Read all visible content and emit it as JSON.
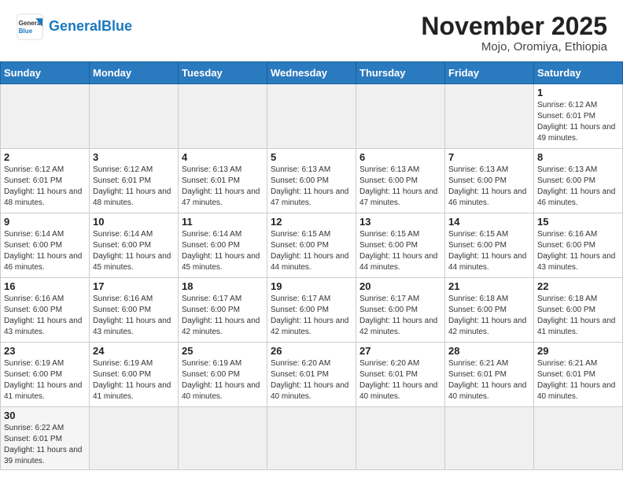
{
  "header": {
    "logo_general": "General",
    "logo_blue": "Blue",
    "month": "November 2025",
    "location": "Mojo, Oromiya, Ethiopia"
  },
  "days_of_week": [
    "Sunday",
    "Monday",
    "Tuesday",
    "Wednesday",
    "Thursday",
    "Friday",
    "Saturday"
  ],
  "weeks": [
    [
      {
        "day": "",
        "empty": true
      },
      {
        "day": "",
        "empty": true
      },
      {
        "day": "",
        "empty": true
      },
      {
        "day": "",
        "empty": true
      },
      {
        "day": "",
        "empty": true
      },
      {
        "day": "",
        "empty": true
      },
      {
        "day": "1",
        "sunrise": "Sunrise: 6:12 AM",
        "sunset": "Sunset: 6:01 PM",
        "daylight": "Daylight: 11 hours and 49 minutes."
      }
    ],
    [
      {
        "day": "2",
        "sunrise": "Sunrise: 6:12 AM",
        "sunset": "Sunset: 6:01 PM",
        "daylight": "Daylight: 11 hours and 48 minutes."
      },
      {
        "day": "3",
        "sunrise": "Sunrise: 6:12 AM",
        "sunset": "Sunset: 6:01 PM",
        "daylight": "Daylight: 11 hours and 48 minutes."
      },
      {
        "day": "4",
        "sunrise": "Sunrise: 6:13 AM",
        "sunset": "Sunset: 6:01 PM",
        "daylight": "Daylight: 11 hours and 47 minutes."
      },
      {
        "day": "5",
        "sunrise": "Sunrise: 6:13 AM",
        "sunset": "Sunset: 6:00 PM",
        "daylight": "Daylight: 11 hours and 47 minutes."
      },
      {
        "day": "6",
        "sunrise": "Sunrise: 6:13 AM",
        "sunset": "Sunset: 6:00 PM",
        "daylight": "Daylight: 11 hours and 47 minutes."
      },
      {
        "day": "7",
        "sunrise": "Sunrise: 6:13 AM",
        "sunset": "Sunset: 6:00 PM",
        "daylight": "Daylight: 11 hours and 46 minutes."
      },
      {
        "day": "8",
        "sunrise": "Sunrise: 6:13 AM",
        "sunset": "Sunset: 6:00 PM",
        "daylight": "Daylight: 11 hours and 46 minutes."
      }
    ],
    [
      {
        "day": "9",
        "sunrise": "Sunrise: 6:14 AM",
        "sunset": "Sunset: 6:00 PM",
        "daylight": "Daylight: 11 hours and 46 minutes."
      },
      {
        "day": "10",
        "sunrise": "Sunrise: 6:14 AM",
        "sunset": "Sunset: 6:00 PM",
        "daylight": "Daylight: 11 hours and 45 minutes."
      },
      {
        "day": "11",
        "sunrise": "Sunrise: 6:14 AM",
        "sunset": "Sunset: 6:00 PM",
        "daylight": "Daylight: 11 hours and 45 minutes."
      },
      {
        "day": "12",
        "sunrise": "Sunrise: 6:15 AM",
        "sunset": "Sunset: 6:00 PM",
        "daylight": "Daylight: 11 hours and 44 minutes."
      },
      {
        "day": "13",
        "sunrise": "Sunrise: 6:15 AM",
        "sunset": "Sunset: 6:00 PM",
        "daylight": "Daylight: 11 hours and 44 minutes."
      },
      {
        "day": "14",
        "sunrise": "Sunrise: 6:15 AM",
        "sunset": "Sunset: 6:00 PM",
        "daylight": "Daylight: 11 hours and 44 minutes."
      },
      {
        "day": "15",
        "sunrise": "Sunrise: 6:16 AM",
        "sunset": "Sunset: 6:00 PM",
        "daylight": "Daylight: 11 hours and 43 minutes."
      }
    ],
    [
      {
        "day": "16",
        "sunrise": "Sunrise: 6:16 AM",
        "sunset": "Sunset: 6:00 PM",
        "daylight": "Daylight: 11 hours and 43 minutes."
      },
      {
        "day": "17",
        "sunrise": "Sunrise: 6:16 AM",
        "sunset": "Sunset: 6:00 PM",
        "daylight": "Daylight: 11 hours and 43 minutes."
      },
      {
        "day": "18",
        "sunrise": "Sunrise: 6:17 AM",
        "sunset": "Sunset: 6:00 PM",
        "daylight": "Daylight: 11 hours and 42 minutes."
      },
      {
        "day": "19",
        "sunrise": "Sunrise: 6:17 AM",
        "sunset": "Sunset: 6:00 PM",
        "daylight": "Daylight: 11 hours and 42 minutes."
      },
      {
        "day": "20",
        "sunrise": "Sunrise: 6:17 AM",
        "sunset": "Sunset: 6:00 PM",
        "daylight": "Daylight: 11 hours and 42 minutes."
      },
      {
        "day": "21",
        "sunrise": "Sunrise: 6:18 AM",
        "sunset": "Sunset: 6:00 PM",
        "daylight": "Daylight: 11 hours and 42 minutes."
      },
      {
        "day": "22",
        "sunrise": "Sunrise: 6:18 AM",
        "sunset": "Sunset: 6:00 PM",
        "daylight": "Daylight: 11 hours and 41 minutes."
      }
    ],
    [
      {
        "day": "23",
        "sunrise": "Sunrise: 6:19 AM",
        "sunset": "Sunset: 6:00 PM",
        "daylight": "Daylight: 11 hours and 41 minutes."
      },
      {
        "day": "24",
        "sunrise": "Sunrise: 6:19 AM",
        "sunset": "Sunset: 6:00 PM",
        "daylight": "Daylight: 11 hours and 41 minutes."
      },
      {
        "day": "25",
        "sunrise": "Sunrise: 6:19 AM",
        "sunset": "Sunset: 6:00 PM",
        "daylight": "Daylight: 11 hours and 40 minutes."
      },
      {
        "day": "26",
        "sunrise": "Sunrise: 6:20 AM",
        "sunset": "Sunset: 6:01 PM",
        "daylight": "Daylight: 11 hours and 40 minutes."
      },
      {
        "day": "27",
        "sunrise": "Sunrise: 6:20 AM",
        "sunset": "Sunset: 6:01 PM",
        "daylight": "Daylight: 11 hours and 40 minutes."
      },
      {
        "day": "28",
        "sunrise": "Sunrise: 6:21 AM",
        "sunset": "Sunset: 6:01 PM",
        "daylight": "Daylight: 11 hours and 40 minutes."
      },
      {
        "day": "29",
        "sunrise": "Sunrise: 6:21 AM",
        "sunset": "Sunset: 6:01 PM",
        "daylight": "Daylight: 11 hours and 40 minutes."
      }
    ],
    [
      {
        "day": "30",
        "sunrise": "Sunrise: 6:22 AM",
        "sunset": "Sunset: 6:01 PM",
        "daylight": "Daylight: 11 hours and 39 minutes."
      },
      {
        "day": "",
        "empty": true
      },
      {
        "day": "",
        "empty": true
      },
      {
        "day": "",
        "empty": true
      },
      {
        "day": "",
        "empty": true
      },
      {
        "day": "",
        "empty": true
      },
      {
        "day": "",
        "empty": true
      }
    ]
  ]
}
